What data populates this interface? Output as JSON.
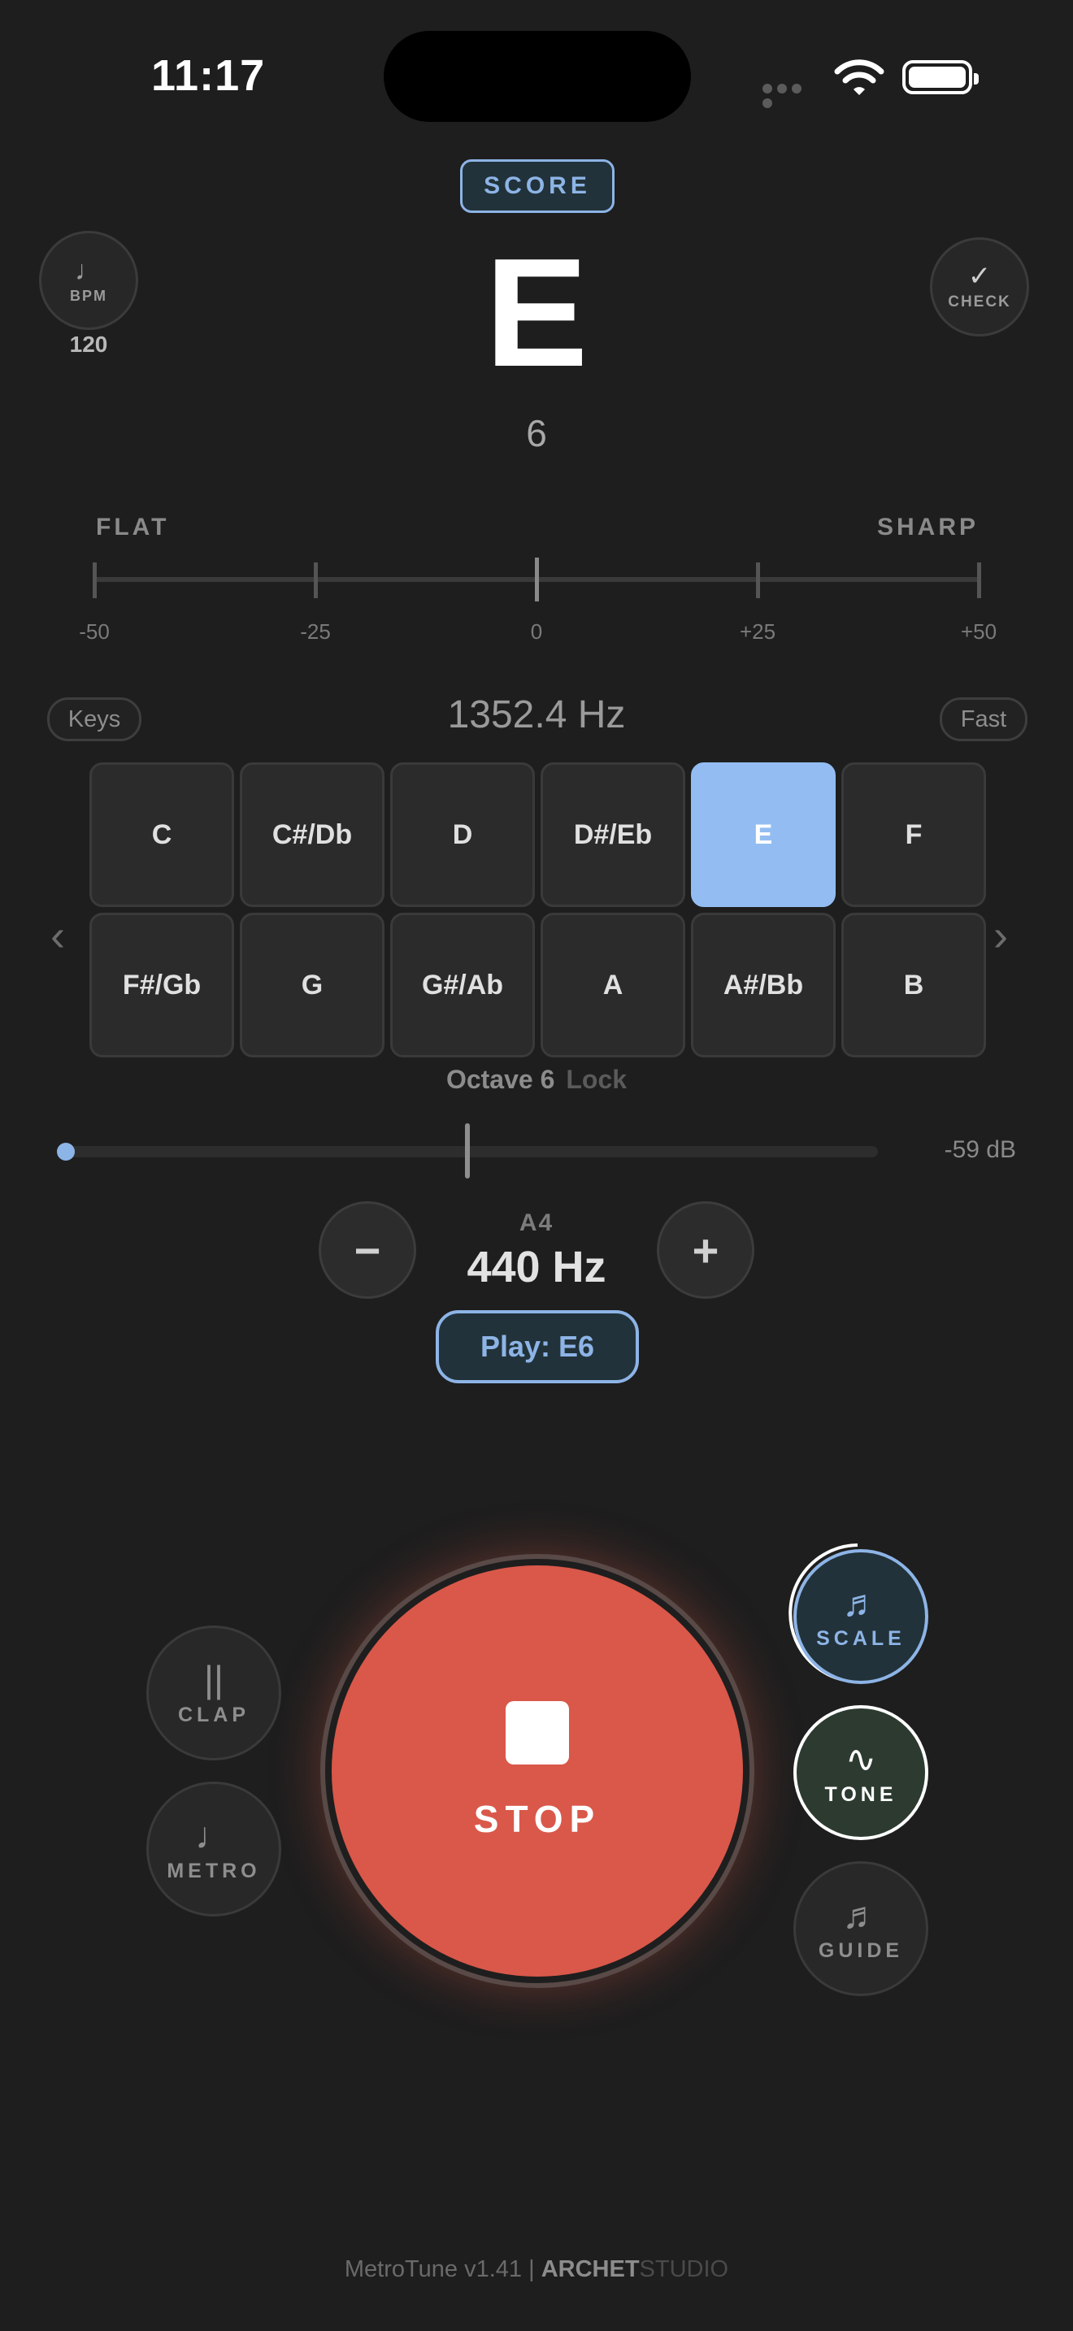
{
  "status": {
    "time": "11:17"
  },
  "header": {
    "score_label": "SCORE",
    "bpm_icon": "♩",
    "bpm_label": "BPM",
    "bpm_value": "120",
    "check_icon": "✓",
    "check_label": "CHECK"
  },
  "tuner": {
    "note": "E",
    "octave": "6",
    "flat_label": "FLAT",
    "sharp_label": "SHARP",
    "ticks": [
      "-50",
      "-25",
      "0",
      "+25",
      "+50"
    ],
    "frequency": "1352.4 Hz",
    "keys_label": "Keys",
    "fast_label": "Fast"
  },
  "keyboard": {
    "row1": [
      "C",
      "C#/Db",
      "D",
      "D#/Eb",
      "E",
      "F"
    ],
    "row2": [
      "F#/Gb",
      "G",
      "G#/Ab",
      "A",
      "A#/Bb",
      "B"
    ],
    "active": "E",
    "prev_icon": "‹",
    "next_icon": "›",
    "octave_label": "Octave 6",
    "lock_label": "Lock"
  },
  "level": {
    "db": "-59 dB"
  },
  "reference": {
    "minus": "−",
    "plus": "+",
    "label": "A4",
    "value": "440 Hz",
    "play_label": "Play: E6"
  },
  "controls": {
    "stop_label": "STOP",
    "clap_icon": "||",
    "clap_label": "CLAP",
    "metro_icon": "♩",
    "metro_label": "METRO",
    "scale_icon": "♬",
    "scale_label": "SCALE",
    "tone_icon": "∿",
    "tone_label": "TONE",
    "guide_icon": "♬",
    "guide_label": "GUIDE"
  },
  "footer": {
    "app": "MetroTune v1.41 |",
    "brand": "ARCHET",
    "studio": "STUDIO"
  },
  "colors": {
    "accent": "#8db4e6",
    "stop": "#d9584a",
    "background": "#1e1e1e"
  }
}
